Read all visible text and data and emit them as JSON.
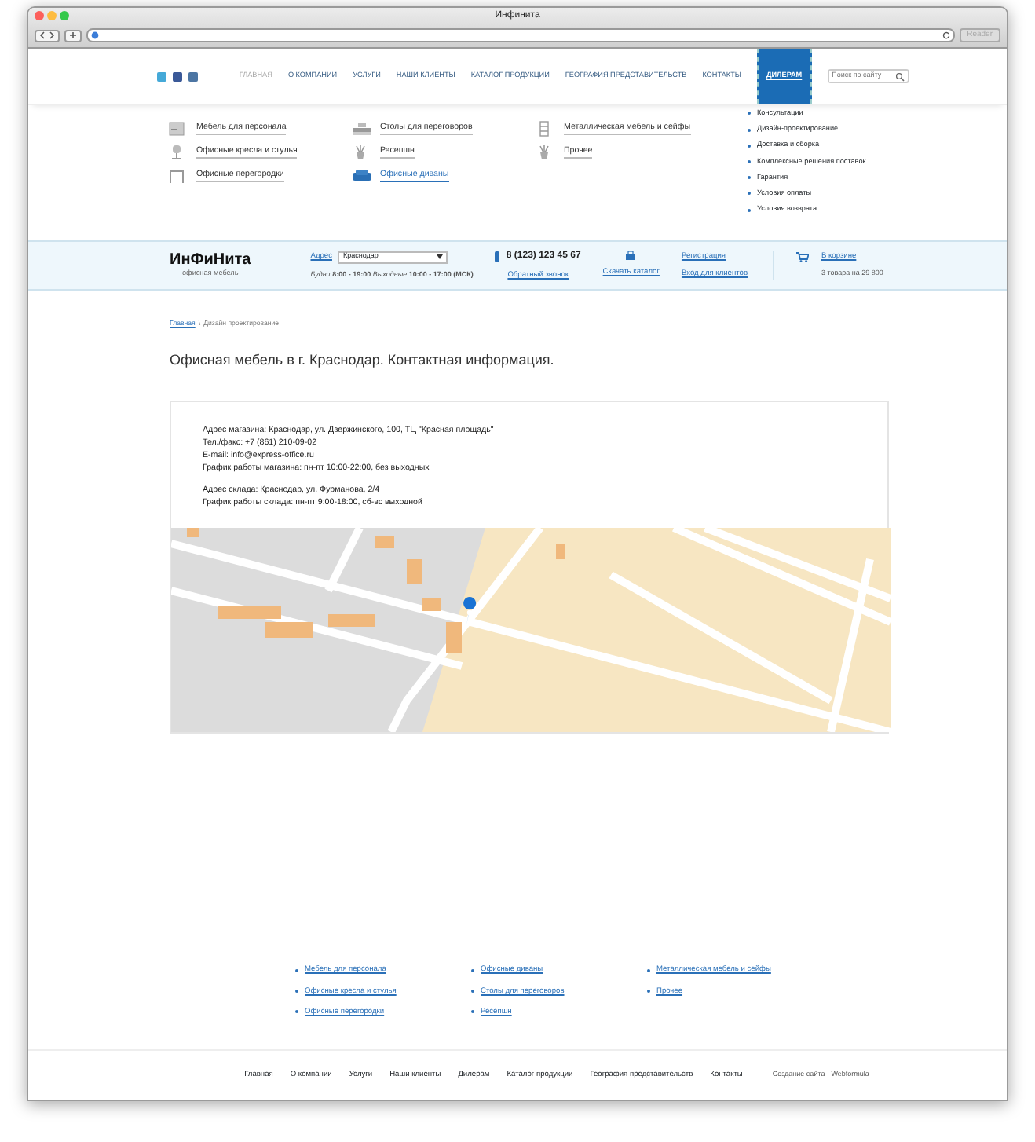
{
  "window": {
    "title": "Инфинита",
    "reader_button": "Reader"
  },
  "nav": {
    "items": [
      {
        "label": "ГЛАВНАЯ",
        "selected": true,
        "kind": "link"
      },
      {
        "label": "О КОМПАНИИ",
        "selected": false,
        "kind": "link"
      },
      {
        "label": "УСЛУГИ",
        "selected": false,
        "kind": "link"
      },
      {
        "label": "НАШИ КЛИЕНТЫ",
        "selected": false,
        "kind": "link"
      },
      {
        "label": "КАТАЛОГ ПРОДУКЦИИ",
        "selected": false,
        "kind": "link"
      },
      {
        "label": "ГЕОГРАФИЯ ПРЕДСТАВИТЕЛЬСТВ",
        "selected": false,
        "kind": "link"
      },
      {
        "label": "КОНТАКТЫ",
        "selected": false,
        "kind": "link"
      },
      {
        "label": "ДИЛЕРАМ",
        "selected": false,
        "kind": "ribbon"
      }
    ],
    "search": {
      "placeholder": "Поиск по сайту"
    }
  },
  "catalog": {
    "columns": [
      [
        {
          "label": "Мебель для персонала",
          "kind": "cabinet",
          "selected": false
        },
        {
          "label": "Офисные кресла и стулья",
          "kind": "chair",
          "selected": false
        },
        {
          "label": "Офисные перегородки",
          "kind": "partition",
          "selected": false
        }
      ],
      [
        {
          "label": "Столы для переговоров",
          "kind": "table",
          "selected": false
        },
        {
          "label": "Ресепшн",
          "kind": "plant",
          "selected": false
        },
        {
          "label": "Офисные диваны",
          "kind": "sofa",
          "selected": true
        }
      ],
      [
        {
          "label": "Металлическая мебель и сейфы",
          "kind": "rack",
          "selected": false
        },
        {
          "label": "Прочее",
          "kind": "plant",
          "selected": false
        }
      ]
    ],
    "services": [
      "Консультации",
      "Дизайн-проектирование",
      "Доставка и сборка",
      "Комплексные решения поставок",
      "Гарантия",
      "Условия оплаты",
      "Условия возврата"
    ]
  },
  "header": {
    "logo": "ИнФиНита",
    "tagline": "офисная мебель",
    "address_label": "Адрес",
    "city": "Краснодар",
    "hours": "*Будни* **8:00 - 19:00** *Выходные* **10:00 - 17:00 (МСК)**",
    "phone": "8 (123) 123 45 67",
    "callback": "Обратный звонок",
    "catalog_link": "Скачать каталог",
    "register": "Регистрация",
    "login": "Вход для клиентов",
    "cart_link": "В корзине",
    "cart_summary": "3 товара на 29 800"
  },
  "breadcrumb": [
    {
      "label": "Главная",
      "kind": "link"
    },
    {
      "label": "\\",
      "kind": "separator"
    },
    {
      "label": "Дизайн проектирование",
      "kind": "current"
    }
  ],
  "heading": "Офисная мебель в г. Краснодар. Контактная информация.",
  "contacts": [
    [
      "Адрес магазина: Краснодар, ул. Дзержинского, 100, ТЦ \"Красная площадь\"",
      "Тел./факс: +7 (861) 210-09-02",
      "E-mail: info@express-office.ru",
      "График работы магазина: пн-пт 10:00-22:00, без выходных"
    ],
    [
      "Адрес склада: Краснодар, ул. Фурманова, 2/4",
      "График работы склада: пн-пт 9:00-18:00, сб-вс выходной"
    ]
  ],
  "footer": {
    "columns": [
      [
        "Мебель для персонала",
        "Офисные кресла и стулья",
        "Офисные перегородки"
      ],
      [
        "Офисные диваны",
        "Столы для переговоров",
        "Ресепшн"
      ],
      [
        "Металлическая мебель и сейфы",
        "Прочее"
      ]
    ],
    "nav": [
      "Главная",
      "О компании",
      "Услуги",
      "Наши клиенты",
      "Дилерам",
      "Каталог продукции",
      "География представительств",
      "Контакты"
    ],
    "credit": "Создание сайта - Webformula"
  }
}
